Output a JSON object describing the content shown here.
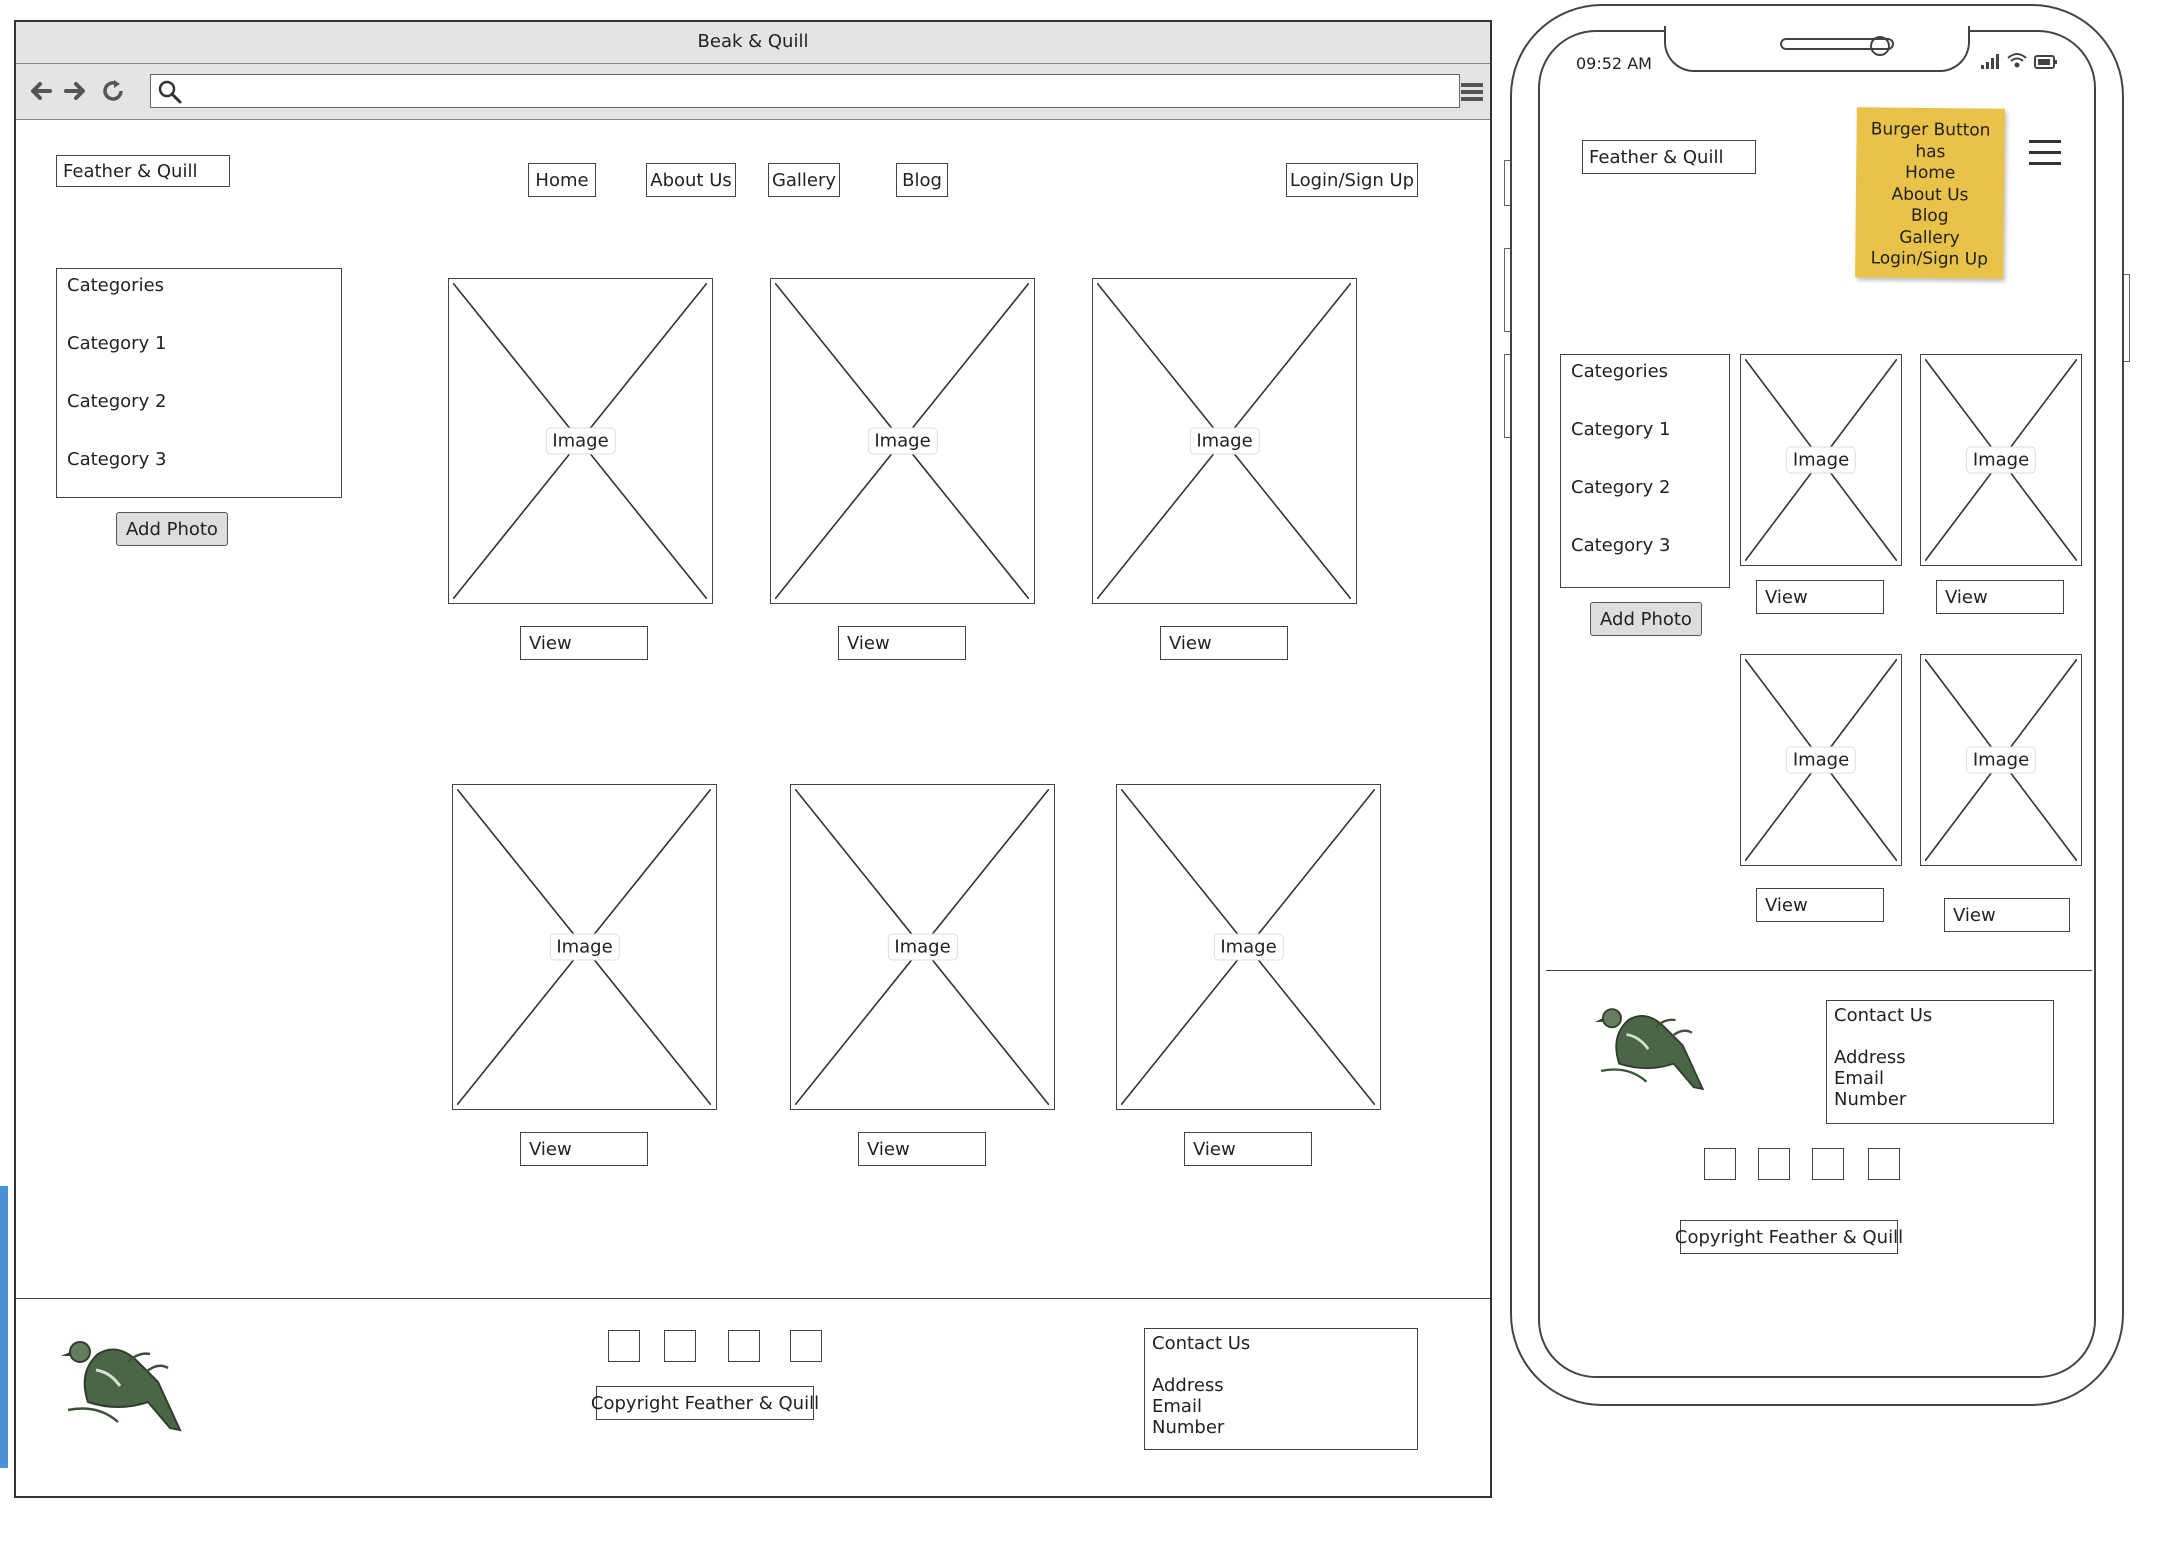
{
  "desktop": {
    "window_title": "Beak & Quill",
    "brand": "Feather & Quill",
    "nav": [
      "Home",
      "About Us",
      "Gallery",
      "Blog"
    ],
    "login": "Login/Sign Up",
    "categories": {
      "title": "Categories",
      "items": [
        "Category 1",
        "Category 2",
        "Category 3"
      ]
    },
    "add_photo": "Add Photo",
    "image_label": "Image",
    "view_label": "View",
    "footer": {
      "copyright": "Copyright Feather & Quill",
      "contact": {
        "title": "Contact Us",
        "lines": [
          "Address",
          "Email",
          "Number"
        ]
      }
    }
  },
  "mobile": {
    "time": "09:52 AM",
    "brand": "Feather & Quill",
    "sticky_note": [
      "Burger Button",
      "has",
      "Home",
      "About Us",
      "Blog",
      "Gallery",
      "Login/Sign Up"
    ],
    "categories": {
      "title": "Categories",
      "items": [
        "Category 1",
        "Category 2",
        "Category 3"
      ]
    },
    "add_photo": "Add Photo",
    "image_label": "Image",
    "view_label": "View",
    "footer": {
      "copyright": "Copyright Feather & Quill",
      "contact": {
        "title": "Contact Us",
        "lines": [
          "Address",
          "Email",
          "Number"
        ]
      }
    }
  },
  "colors": {
    "sticky": "#e9c24a",
    "accent_bar": "#4a90d9",
    "bird": "#3f5a3a"
  }
}
